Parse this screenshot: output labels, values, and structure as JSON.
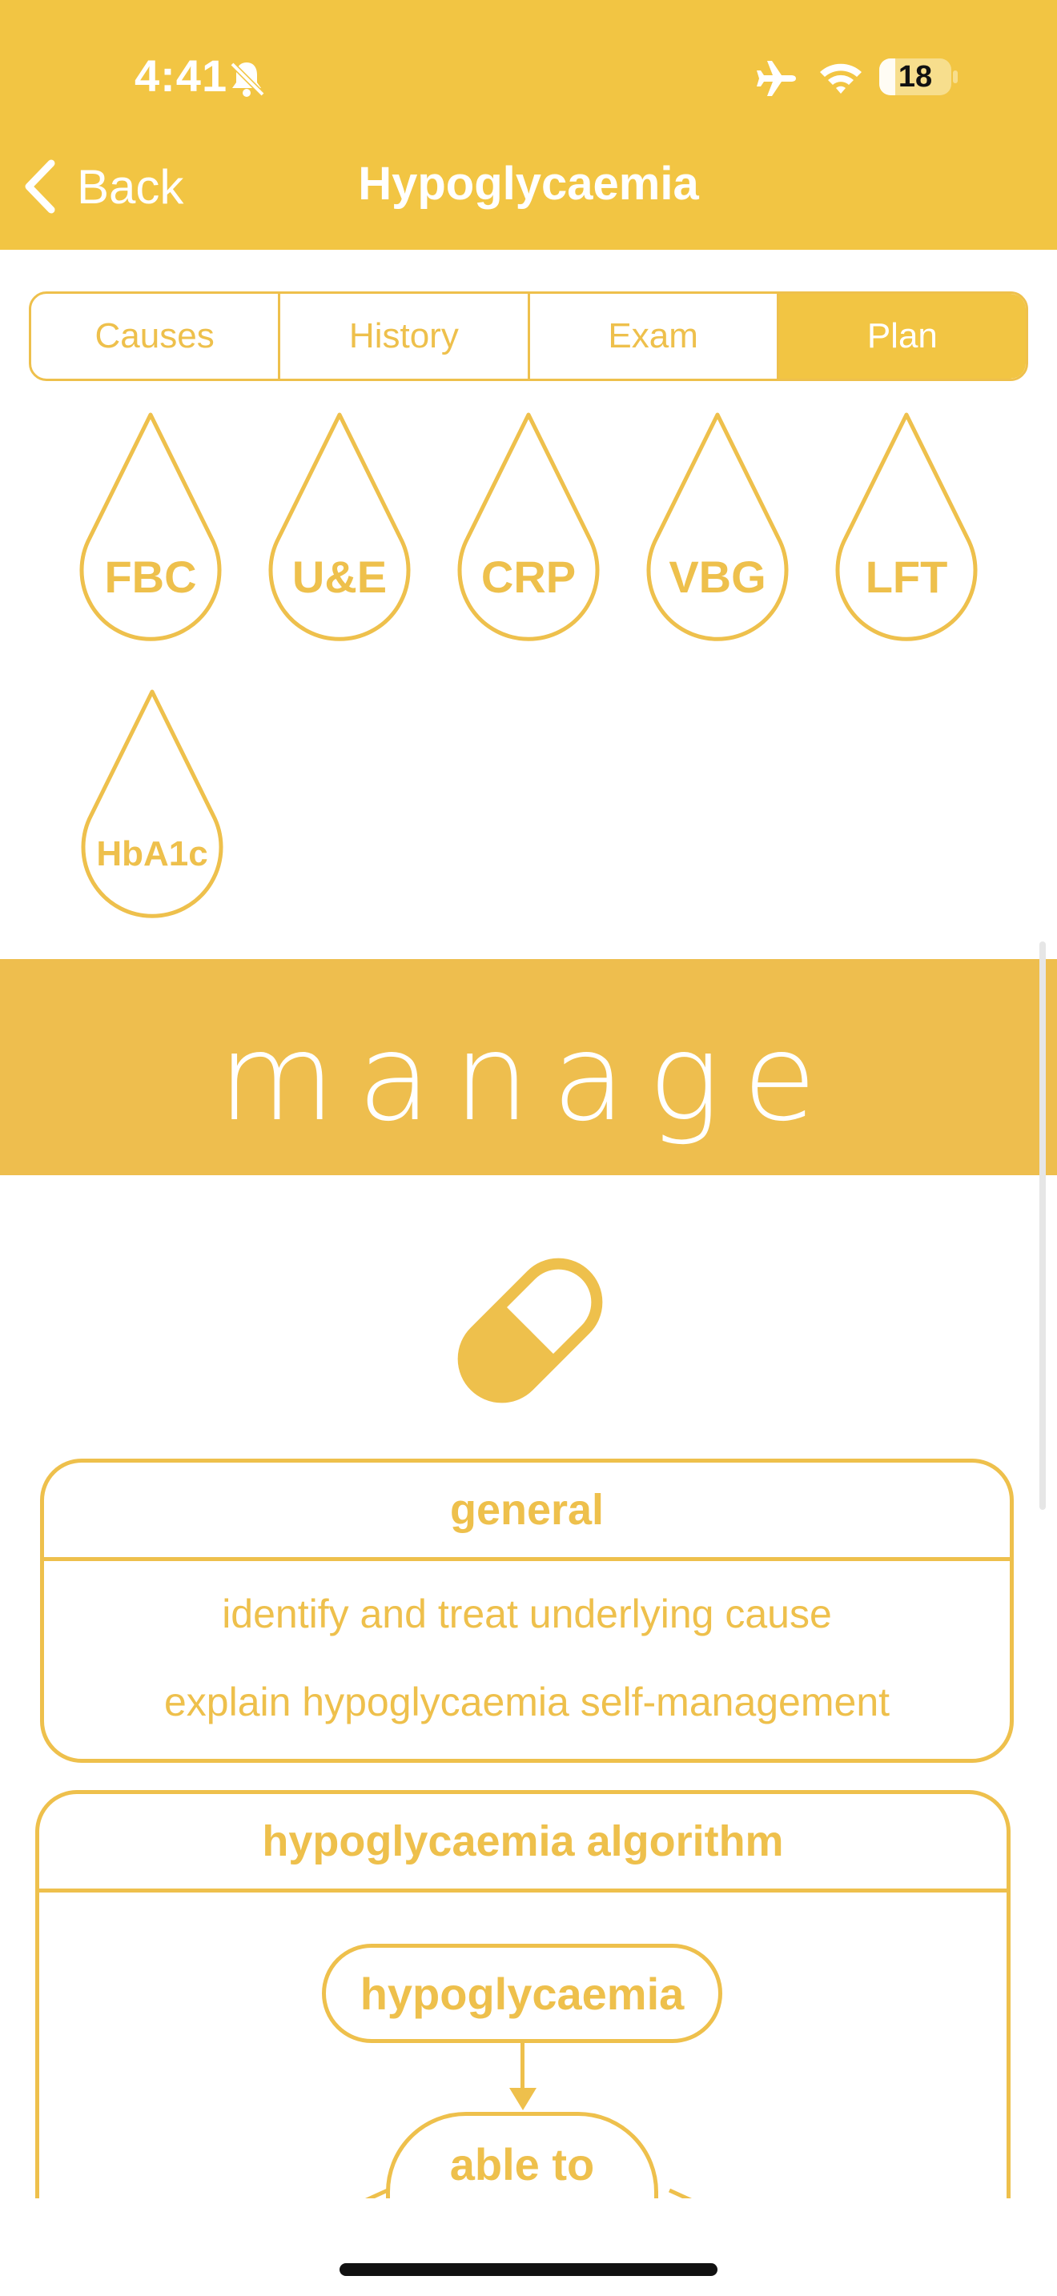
{
  "status_bar": {
    "time": "4:41",
    "battery": "18"
  },
  "nav": {
    "back_label": "Back",
    "title": "Hypoglycaemia"
  },
  "tabs": [
    {
      "label": "Causes",
      "active": false
    },
    {
      "label": "History",
      "active": false
    },
    {
      "label": "Exam",
      "active": false
    },
    {
      "label": "Plan",
      "active": true
    }
  ],
  "investigations": [
    "FBC",
    "U&E",
    "CRP",
    "VBG",
    "LFT",
    "HbA1c"
  ],
  "section_heading": "manage",
  "general_box": {
    "title": "general",
    "items": [
      "identify and treat underlying cause",
      "explain hypoglycaemia self-management"
    ]
  },
  "algorithm_box": {
    "title": "hypoglycaemia algorithm",
    "start_node": "hypoglycaemia",
    "next_node": "able to"
  },
  "colors": {
    "accent": "#F2C543",
    "banner": "#EEBE4E",
    "outline": "#EEC04C"
  }
}
